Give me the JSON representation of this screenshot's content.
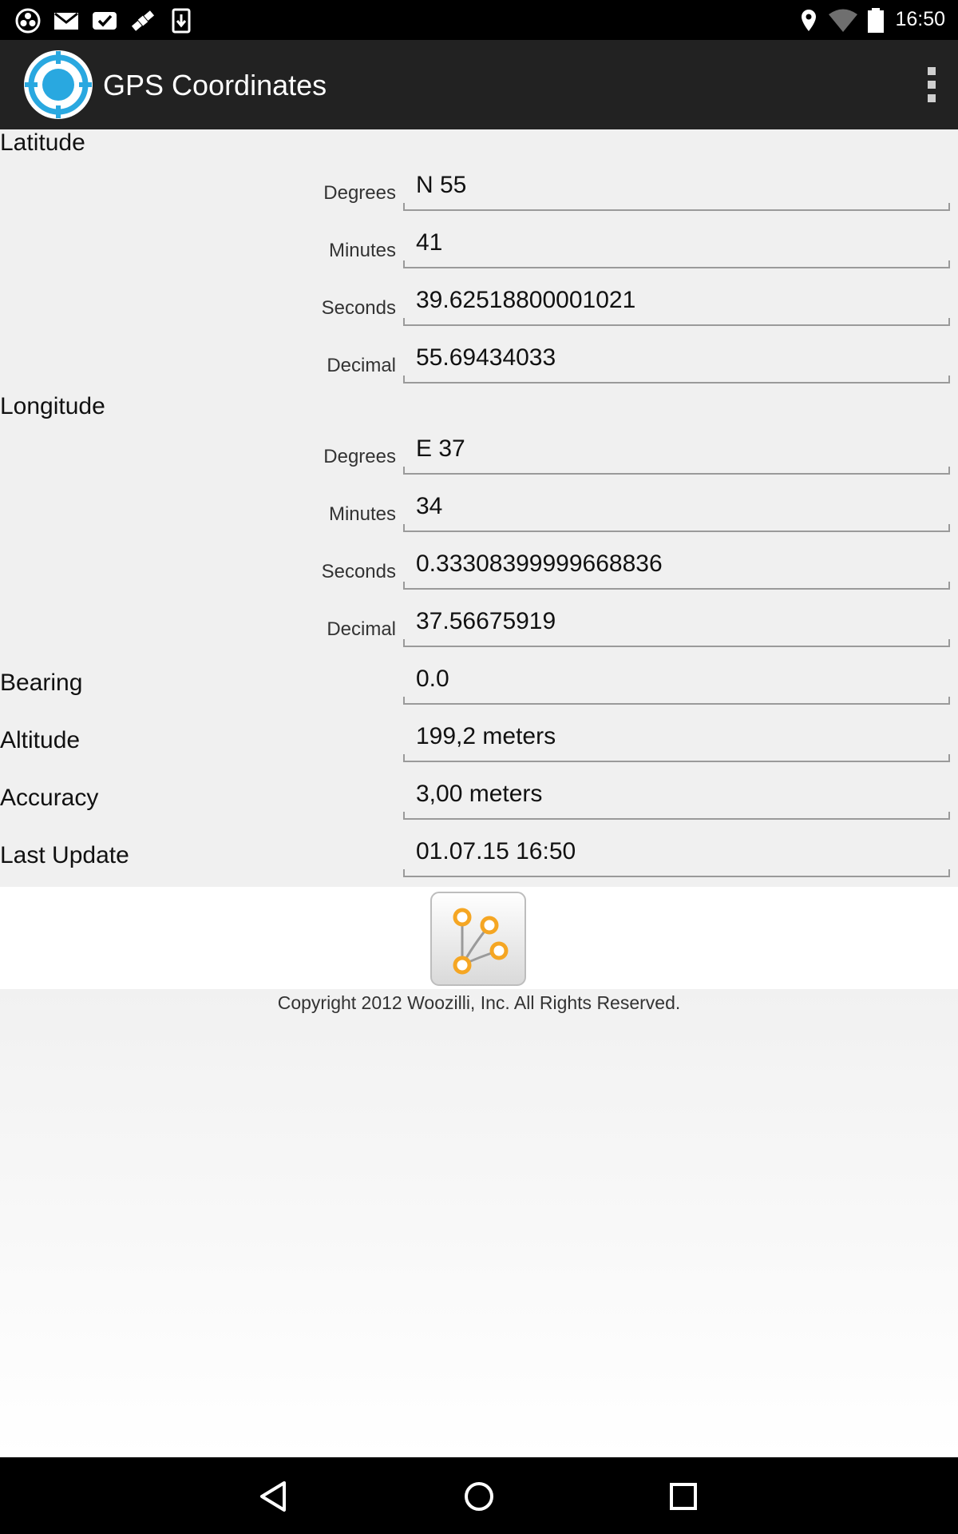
{
  "status_bar": {
    "time": "16:50",
    "left_icons": [
      "camera-aperture-icon",
      "gmail-icon",
      "checkmark-badge-icon",
      "satellite-icon",
      "download-icon"
    ],
    "right_icons": [
      "location-pin-icon",
      "wifi-icon",
      "battery-icon"
    ]
  },
  "app_bar": {
    "title": "GPS Coordinates",
    "logo": "target-icon",
    "menu": "overflow-menu-icon"
  },
  "latitude": {
    "title": "Latitude",
    "degrees_label": "Degrees",
    "degrees": "N 55",
    "minutes_label": "Minutes",
    "minutes": "41",
    "seconds_label": "Seconds",
    "seconds": "39.62518800001021",
    "decimal_label": "Decimal",
    "decimal": "55.69434033"
  },
  "longitude": {
    "title": "Longitude",
    "degrees_label": "Degrees",
    "degrees": "E 37",
    "minutes_label": "Minutes",
    "minutes": "34",
    "seconds_label": "Seconds",
    "seconds": "0.33308399999668836",
    "decimal_label": "Decimal",
    "decimal": "37.56675919"
  },
  "bearing": {
    "label": "Bearing",
    "value": "0.0"
  },
  "altitude": {
    "label": "Altitude",
    "value": "199,2 meters"
  },
  "accuracy": {
    "label": "Accuracy",
    "value": "3,00 meters"
  },
  "last_update": {
    "label": "Last Update",
    "value": "01.07.15 16:50"
  },
  "footer": {
    "logo": "woozilli-logo-icon",
    "copyright": "Copyright 2012 Woozilli, Inc.  All Rights Reserved."
  },
  "nav_bar": {
    "buttons": [
      "back-icon",
      "home-icon",
      "recents-icon"
    ]
  },
  "colors": {
    "accent": "#29a8e0",
    "appbar": "#222222",
    "content_bg": "#f0f0f0",
    "logo_orange": "#f5a623"
  }
}
